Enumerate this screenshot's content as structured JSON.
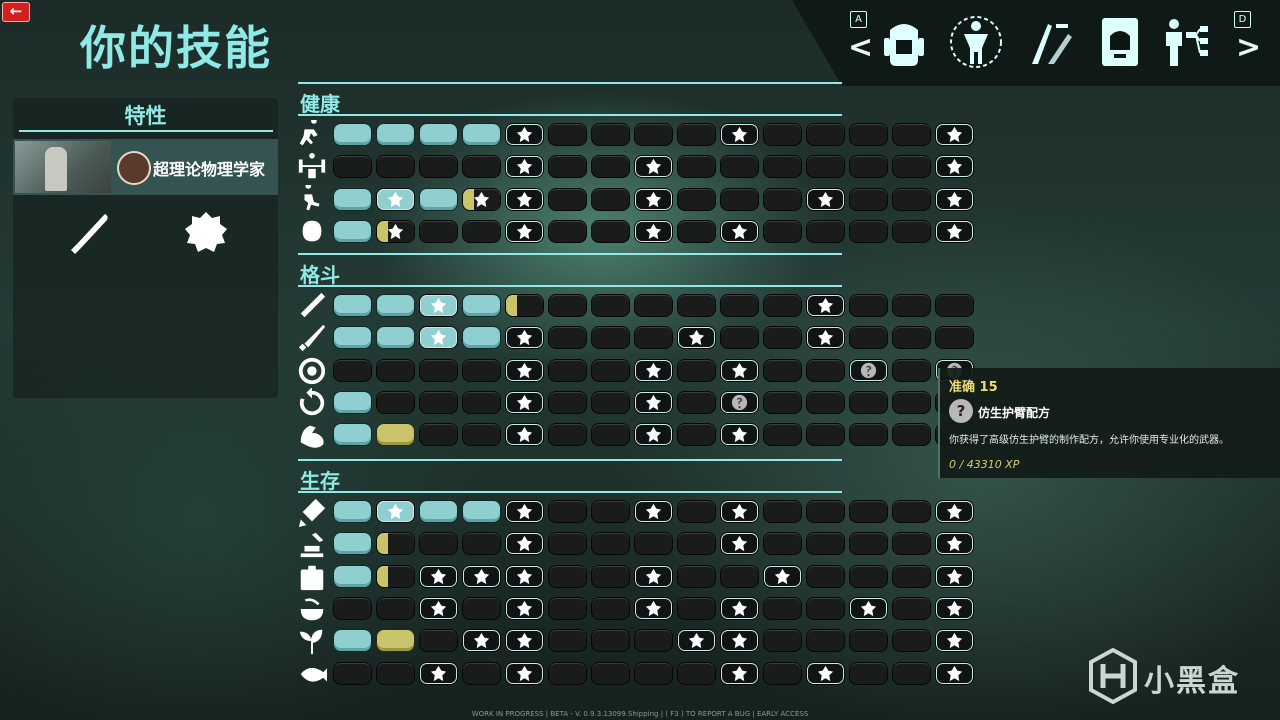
{
  "back_button": {
    "label": "←"
  },
  "title": "你的技能",
  "top_nav": {
    "left_key": "A",
    "right_key": "D",
    "tabs": [
      "backpack",
      "character",
      "crafting",
      "journal",
      "skills"
    ]
  },
  "traits_panel": {
    "title": "特性",
    "trait_name": "超理论物理学家",
    "items": [
      "baseball-bat",
      "leather"
    ]
  },
  "sections": [
    {
      "label": "健康",
      "rows": [
        {
          "icon": "running-icon",
          "slots": [
            "f",
            "f",
            "f",
            "f",
            "P*",
            "e",
            "e",
            "e",
            "e",
            "p",
            "e",
            "e",
            "e",
            "e",
            "p"
          ]
        },
        {
          "icon": "weightlifter-icon",
          "slots": [
            "e",
            "e",
            "e",
            "e",
            "p",
            "e",
            "e",
            "p",
            "e",
            "e",
            "e",
            "e",
            "e",
            "e",
            "p"
          ]
        },
        {
          "icon": "sneaking-icon",
          "slots": [
            "f",
            "pf",
            "f",
            "pS",
            "p",
            "e",
            "e",
            "p",
            "e",
            "e",
            "e",
            "p",
            "e",
            "e",
            "p"
          ]
        },
        {
          "icon": "ninja-icon",
          "slots": [
            "f",
            "pS",
            "e",
            "e",
            "p",
            "e",
            "e",
            "p",
            "e",
            "p",
            "e",
            "e",
            "e",
            "e",
            "p"
          ]
        }
      ]
    },
    {
      "label": "格斗",
      "rows": [
        {
          "icon": "bat-icon",
          "slots": [
            "f",
            "f",
            "pf",
            "f",
            "S",
            "e",
            "e",
            "e",
            "e",
            "e",
            "e",
            "p",
            "e",
            "e",
            "e"
          ]
        },
        {
          "icon": "blade-icon",
          "slots": [
            "f",
            "f",
            "pf",
            "f",
            "p",
            "e",
            "e",
            "e",
            "p",
            "e",
            "e",
            "p",
            "e",
            "e",
            "e"
          ]
        },
        {
          "icon": "crosshair-icon",
          "slots": [
            "e",
            "e",
            "e",
            "e",
            "p",
            "e",
            "e",
            "p",
            "e",
            "p",
            "e",
            "e",
            "q",
            "e",
            "q"
          ]
        },
        {
          "icon": "reload-icon",
          "slots": [
            "f",
            "e",
            "e",
            "e",
            "p",
            "e",
            "e",
            "p",
            "e",
            "q",
            "e",
            "e",
            "e",
            "e",
            "e"
          ]
        },
        {
          "icon": "muscle-icon",
          "slots": [
            "f",
            "L",
            "e",
            "e",
            "p",
            "e",
            "e",
            "p",
            "e",
            "p",
            "e",
            "e",
            "e",
            "e",
            "e"
          ]
        }
      ]
    },
    {
      "label": "生存",
      "rows": [
        {
          "icon": "glue-icon",
          "slots": [
            "f",
            "pf",
            "f",
            "f",
            "p",
            "e",
            "e",
            "p",
            "e",
            "p",
            "e",
            "e",
            "e",
            "e",
            "p"
          ]
        },
        {
          "icon": "build-icon",
          "slots": [
            "f",
            "S",
            "e",
            "e",
            "p",
            "e",
            "e",
            "e",
            "e",
            "p",
            "e",
            "e",
            "e",
            "e",
            "p"
          ]
        },
        {
          "icon": "medkit-icon",
          "slots": [
            "f",
            "S",
            "p",
            "p",
            "p",
            "e",
            "e",
            "p",
            "e",
            "e",
            "p",
            "e",
            "e",
            "e",
            "p"
          ]
        },
        {
          "icon": "cooking-icon",
          "slots": [
            "e",
            "e",
            "p",
            "e",
            "p",
            "e",
            "e",
            "p",
            "e",
            "p",
            "e",
            "e",
            "p",
            "e",
            "p"
          ]
        },
        {
          "icon": "farming-icon",
          "slots": [
            "f",
            "L",
            "e",
            "p",
            "p",
            "e",
            "e",
            "e",
            "p",
            "p",
            "e",
            "e",
            "e",
            "e",
            "p"
          ]
        },
        {
          "icon": "fishing-icon",
          "slots": [
            "e",
            "e",
            "p",
            "e",
            "p",
            "e",
            "e",
            "e",
            "e",
            "p",
            "e",
            "p",
            "e",
            "e",
            "p"
          ]
        }
      ]
    }
  ],
  "tooltip": {
    "title": "准确 15",
    "icon_glyph": "?",
    "name": "仿生护臂配方",
    "description": "你获得了高级仿生护臂的制作配方，允许你使用专业化的武器。",
    "xp": "0 / 43310 XP"
  },
  "footer": "WORK IN PROGRESS | BETA - V. 0.9.3.13099.Shipping | ( F3 ) TO REPORT A BUG | EARLY ACCESS",
  "watermark": "小黑盒",
  "colors": {
    "accent": "#8fe9e6",
    "filled": "#8fcfd0",
    "partial": "#c9c36a",
    "tooltip_title": "#ecdc78"
  }
}
